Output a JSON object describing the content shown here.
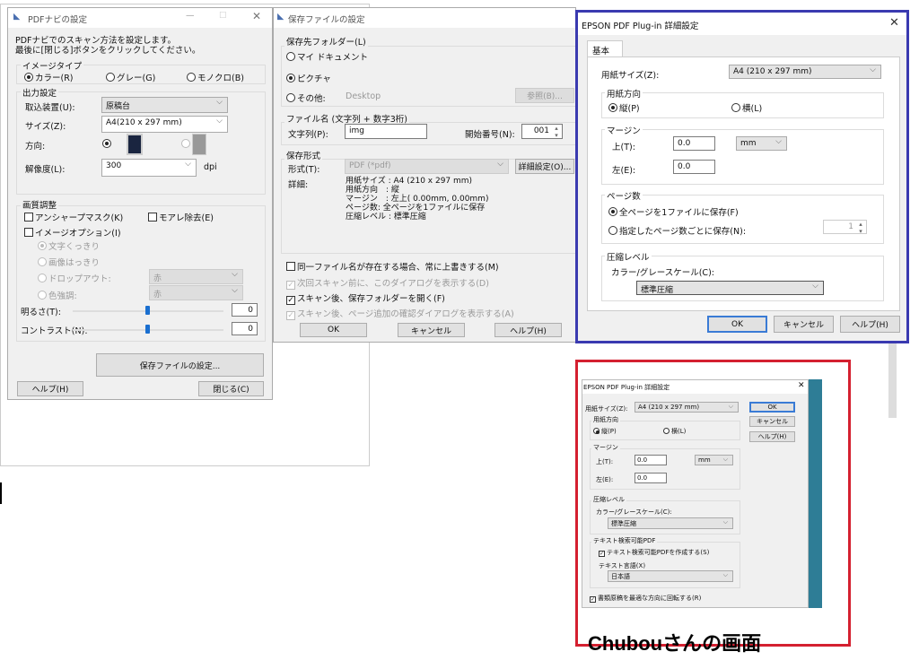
{
  "pdfnavi": {
    "title": "PDFナビの設定",
    "intro1": "PDFナビでのスキャン方法を設定します。",
    "intro2": "最後に[閉じる]ボタンをクリックしてください。",
    "image_type": {
      "label": "イメージタイプ",
      "options": [
        "カラー(R)",
        "グレー(G)",
        "モノクロ(B)"
      ],
      "selected": 0
    },
    "output": {
      "label": "出力設定",
      "source_label": "取込装置(U):",
      "source": "原稿台",
      "size_label": "サイズ(Z):",
      "size": "A4(210 x 297 mm)",
      "orientation_label": "方向:",
      "resolution_label": "解像度(L):",
      "resolution": "300",
      "dpi": "dpi"
    },
    "quality": {
      "label": "画質調整",
      "unsharp": "アンシャープマスク(K)",
      "moire": "モアレ除去(E)",
      "image_option": "イメージオプション(I)",
      "opt_text": "文字くっきり",
      "opt_image": "画像はっきり",
      "opt_dropout": "ドロップアウト:",
      "dropout_color": "赤",
      "opt_color": "色強調:",
      "enhance_color": "赤",
      "brightness_label": "明るさ(T):",
      "brightness": "0",
      "contrast_label": "コントラスト(N):",
      "contrast": "0"
    },
    "save_file_button": "保存ファイルの設定...",
    "help_button": "ヘルプ(H)",
    "close_button": "閉じる(C)"
  },
  "savefile": {
    "title": "保存ファイルの設定",
    "folder_label": "保存先フォルダー(L)",
    "my_docs": "マイ ドキュメント",
    "pictures": "ピクチャ",
    "other": "その他:",
    "other_path": "Desktop",
    "browse": "参照(B)...",
    "filename_label": "ファイル名 (文字列 + 数字3桁)",
    "prefix_label": "文字列(P):",
    "prefix": "img",
    "start_label": "開始番号(N):",
    "start": "001",
    "format_group": "保存形式",
    "format_label": "形式(T):",
    "format": "PDF (*pdf)",
    "detail_button": "詳細設定(O)...",
    "details_label": "詳細:",
    "details": [
      "用紙サイズ : A4 (210 x 297 mm)",
      "用紙方向　: 縦",
      "マージン　: 左上( 0.00mm, 0.00mm)",
      "ページ数: 全ページを1ファイルに保存",
      "圧縮レベル : 標準圧縮"
    ],
    "overwrite": "同一ファイル名が存在する場合、常に上書きする(M)",
    "show_next": "次回スキャン前に、このダイアログを表示する(D)",
    "open_folder": "スキャン後、保存フォルダーを開く(F)",
    "confirm_add": "スキャン後、ページ追加の確認ダイアログを表示する(A)",
    "ok": "OK",
    "cancel": "キャンセル",
    "help": "ヘルプ(H)"
  },
  "plugin": {
    "title": "EPSON PDF Plug-in 詳細設定",
    "tab": "基本",
    "paper_label": "用紙サイズ(Z):",
    "paper": "A4 (210 x 297 mm)",
    "orient_group": "用紙方向",
    "portrait": "縦(P)",
    "landscape": "横(L)",
    "margin_group": "マージン",
    "top_label": "上(T):",
    "top": "0.0",
    "unit": "mm",
    "left_label": "左(E):",
    "left": "0.0",
    "pages_group": "ページ数",
    "all_pages": "全ページを1ファイルに保存(F)",
    "per_pages": "指定したページ数ごとに保存(N):",
    "per_pages_value": "1",
    "compress_group": "圧縮レベル",
    "color_label": "カラー/グレースケール(C):",
    "compress": "標準圧縮",
    "ok": "OK",
    "cancel": "キャンセル",
    "help": "ヘルプ(H)",
    "highlight_color": "#3a3ab0"
  },
  "chubou": {
    "title": "EPSON PDF Plug-in 詳細設定",
    "paper_label": "用紙サイズ(Z):",
    "paper": "A4 (210 x 297 mm)",
    "ok": "OK",
    "cancel": "キャンセル",
    "help": "ヘルプ(H)",
    "orient_group": "用紙方向",
    "portrait": "縦(P)",
    "landscape": "横(L)",
    "margin_group": "マージン",
    "top_label": "上(T):",
    "top": "0.0",
    "unit": "mm",
    "left_label": "左(E):",
    "left": "0.0",
    "compress_group": "圧縮レベル",
    "color_label": "カラー/グレースケール(C):",
    "compress": "標準圧縮",
    "ocr_group": "テキスト検索可能PDF",
    "ocr_check": "テキスト検索可能PDFを作成する(S)",
    "lang_label": "テキスト言語(X)",
    "lang": "日本語",
    "rotate": "書類原稿を最適な方向に回転する(R)",
    "caption": "Chubouさんの画面",
    "highlight_color": "#d42030"
  }
}
